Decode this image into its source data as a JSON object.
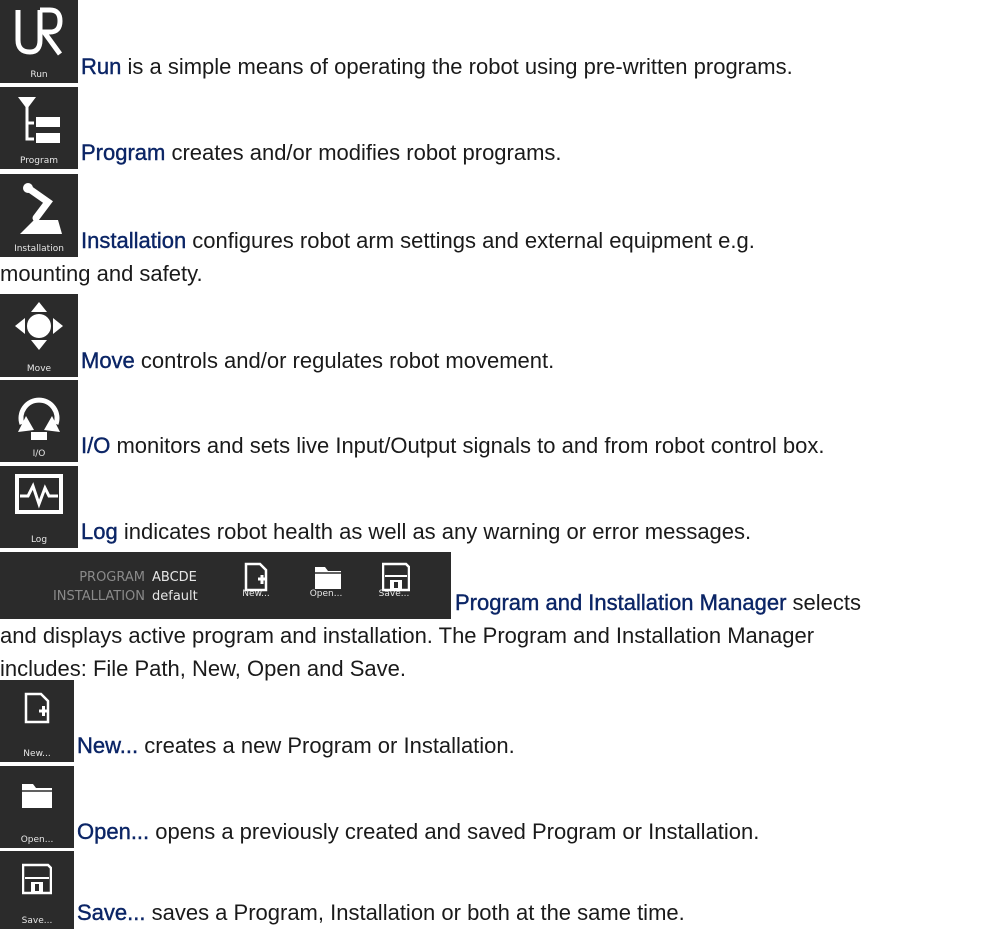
{
  "entries": [
    {
      "icon_label": "Run",
      "icon_name": "ur-logo-icon",
      "term": "Run",
      "desc": " is a simple means of operating the robot using pre-written programs."
    },
    {
      "icon_label": "Program",
      "icon_name": "program-tree-icon",
      "term": "Program",
      "desc": " creates and/or modifies robot programs."
    },
    {
      "icon_label": "Installation",
      "icon_name": "robot-arm-icon",
      "term": "Installation",
      "desc": " configures robot arm settings and external equipment e.g.",
      "desc2": "mounting and safety."
    },
    {
      "icon_label": "Move",
      "icon_name": "move-arrows-icon",
      "term": "Move",
      "desc": " controls and/or regulates robot movement."
    },
    {
      "icon_label": "I/O",
      "icon_name": "io-cycle-icon",
      "term": "I/O",
      "desc": " monitors and sets live Input/Output signals to and from robot control box."
    },
    {
      "icon_label": "Log",
      "icon_name": "log-pulse-icon",
      "term": "Log",
      "desc": " indicates robot health as well as any warning or error messages."
    }
  ],
  "manager": {
    "program_label": "PROGRAM",
    "program_value": "ABCDE",
    "installation_label": "INSTALLATION",
    "installation_value": "default",
    "new_label": "New...",
    "open_label": "Open...",
    "save_label": "Save...",
    "term": "Program and Installation Manager",
    "desc": " selects",
    "desc2": "and displays active program and installation. The Program and Installation Manager",
    "desc3": "includes: File Path, New, Open and Save."
  },
  "file_entries": [
    {
      "icon_label": "New...",
      "icon_name": "new-file-icon",
      "term": "New...",
      "desc": " creates a new Program or Installation."
    },
    {
      "icon_label": "Open...",
      "icon_name": "open-folder-icon",
      "term": "Open...",
      "desc": " opens a previously created and saved Program or Installation."
    },
    {
      "icon_label": "Save...",
      "icon_name": "save-disk-icon",
      "term": "Save...",
      "desc": " saves a Program, Installation or both at the same time."
    }
  ]
}
